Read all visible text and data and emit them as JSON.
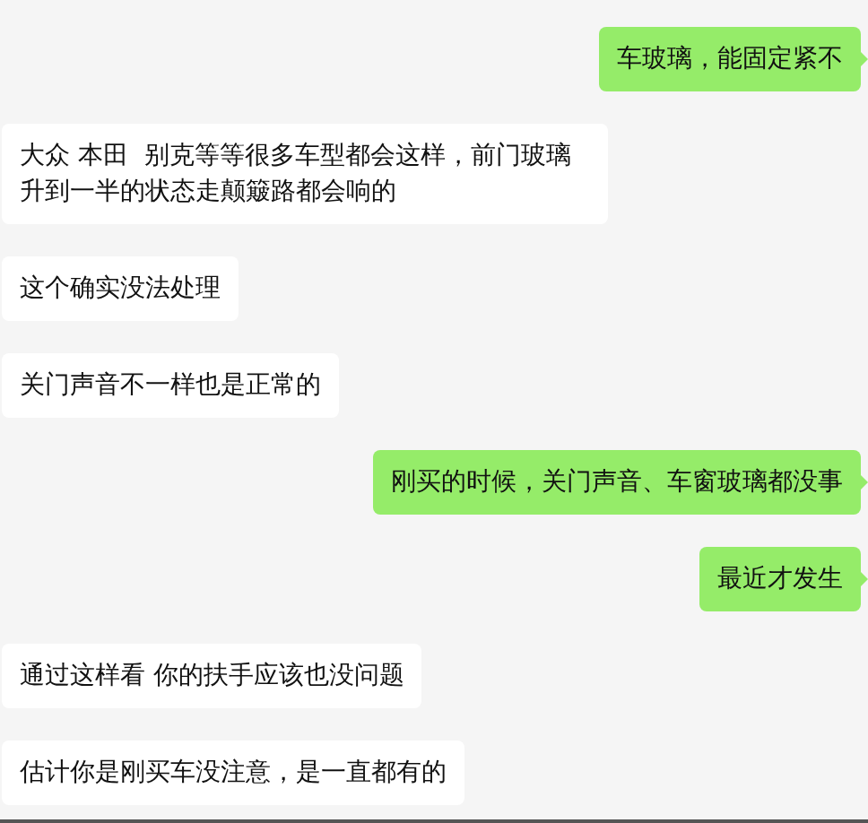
{
  "messages": [
    {
      "kind": "sent",
      "text": "车玻璃，能固定紧不"
    },
    {
      "kind": "received",
      "text": "大众 本田  别克等等很多车型都会这样，前门玻璃升到一半的状态走颠簸路都会响的"
    },
    {
      "kind": "received",
      "text": "这个确实没法处理"
    },
    {
      "kind": "received",
      "text": "关门声音不一样也是正常的"
    },
    {
      "kind": "sent",
      "text": "刚买的时候，关门声音、车窗玻璃都没事"
    },
    {
      "kind": "sent",
      "text": "最近才发生"
    },
    {
      "kind": "received",
      "text": "通过这样看 你的扶手应该也没问题"
    },
    {
      "kind": "received",
      "text": "估计你是刚买车没注意，是一直都有的"
    }
  ]
}
